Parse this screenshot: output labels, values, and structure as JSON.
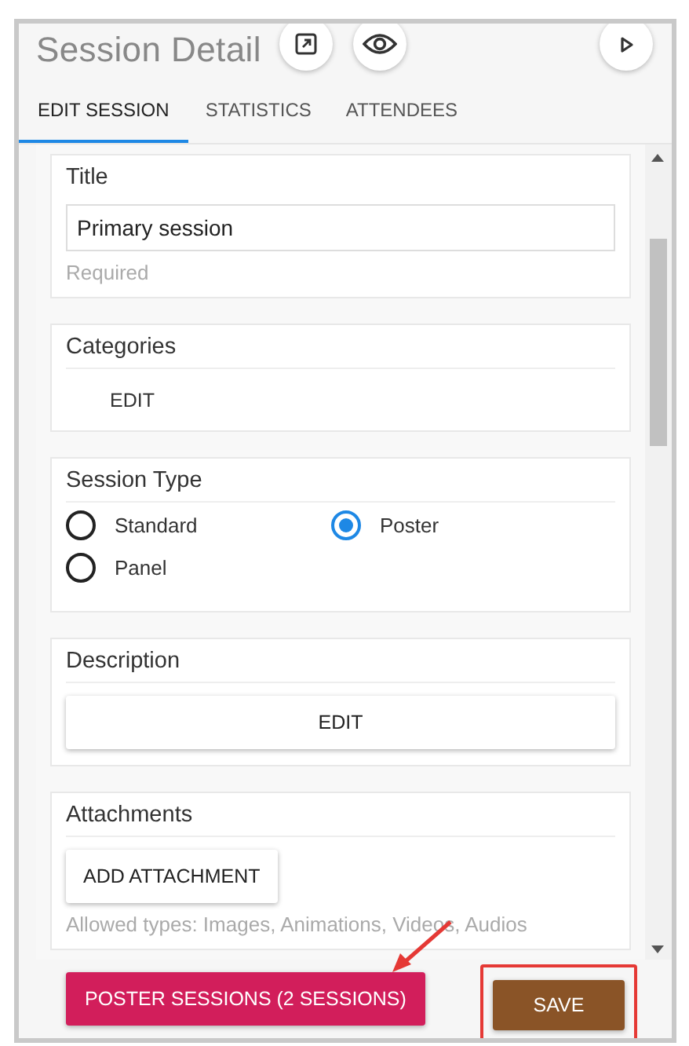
{
  "header": {
    "title": "Session Detail"
  },
  "tabs": [
    {
      "label": "EDIT SESSION",
      "selected": true
    },
    {
      "label": "STATISTICS",
      "selected": false
    },
    {
      "label": "ATTENDEES",
      "selected": false
    }
  ],
  "title_card": {
    "heading": "Title",
    "value": "Primary session",
    "hint": "Required"
  },
  "categories_card": {
    "heading": "Categories",
    "button": "EDIT"
  },
  "session_type_card": {
    "heading": "Session Type",
    "options": [
      {
        "label": "Standard",
        "selected": false
      },
      {
        "label": "Poster",
        "selected": true
      },
      {
        "label": "Panel",
        "selected": false
      }
    ]
  },
  "description_card": {
    "heading": "Description",
    "button": "EDIT"
  },
  "attachments_card": {
    "heading": "Attachments",
    "button": "ADD ATTACHMENT",
    "hint": "Allowed types: Images, Animations, Videos, Audios"
  },
  "footer": {
    "secondary_button": "POSTER SESSIONS (2 SESSIONS)",
    "primary_button": "SAVE"
  }
}
